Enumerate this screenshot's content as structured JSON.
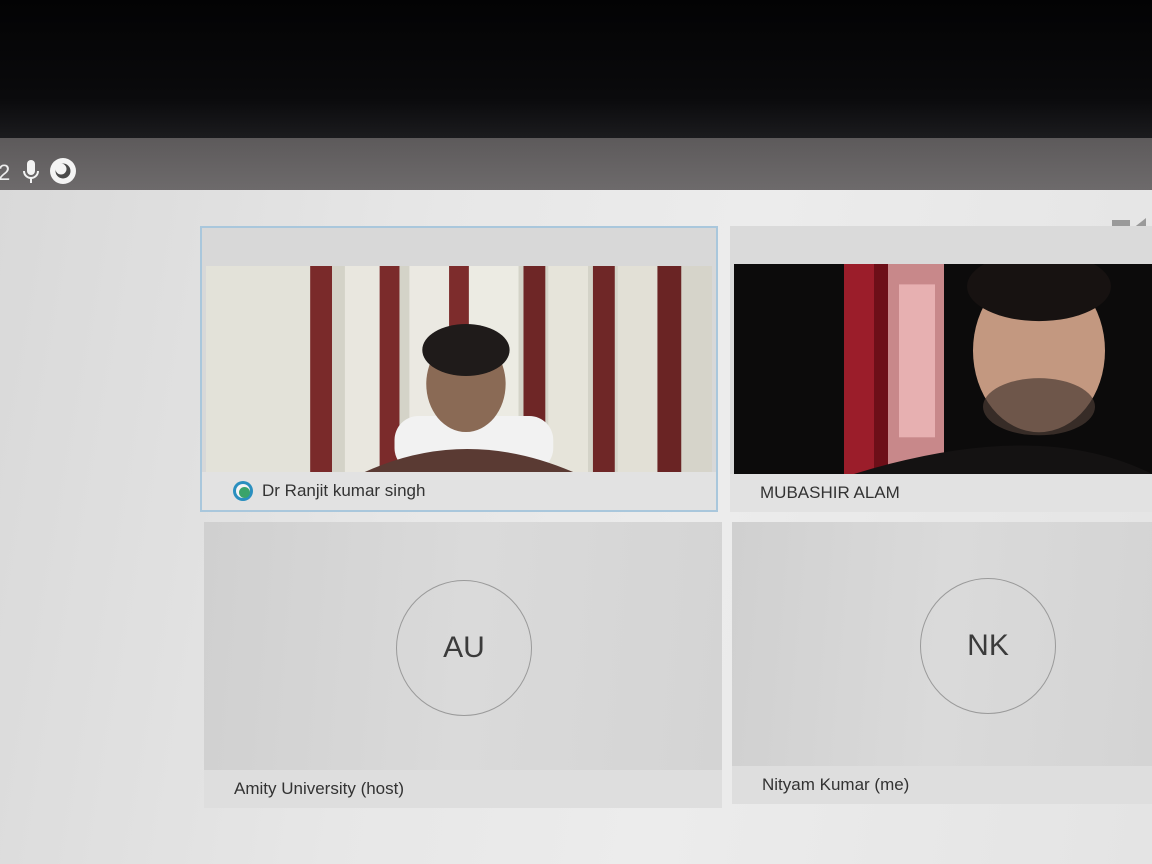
{
  "toolbar": {
    "participant_count": "2",
    "mic_icon": "microphone-icon",
    "status_icon": "connection-status-icon"
  },
  "participants": [
    {
      "name": "Dr Ranjit kumar singh",
      "initials": "",
      "video": true,
      "active_speaker": true
    },
    {
      "name": "MUBASHIR ALAM",
      "initials": "",
      "video": true,
      "active_speaker": false
    },
    {
      "name": "Amity University (host)",
      "initials": "AU",
      "video": false,
      "active_speaker": false
    },
    {
      "name": "Nityam Kumar (me)",
      "initials": "NK",
      "video": false,
      "active_speaker": false
    }
  ],
  "colors": {
    "active_border": "#a9c7dc",
    "accent": "#2a8fbf"
  }
}
